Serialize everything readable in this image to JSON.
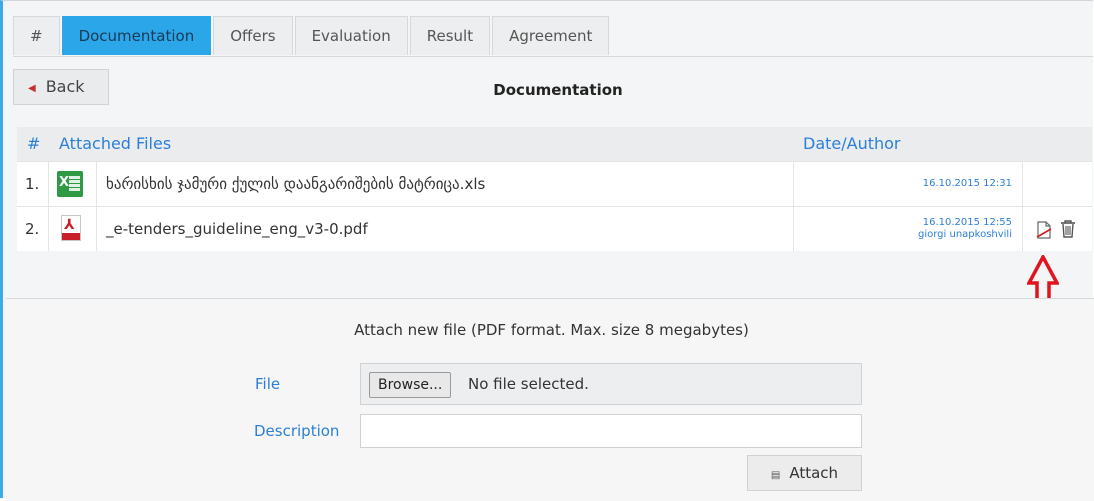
{
  "tabs": [
    {
      "label": "#"
    },
    {
      "label": "Documentation",
      "active": true
    },
    {
      "label": "Offers"
    },
    {
      "label": "Evaluation"
    },
    {
      "label": "Result"
    },
    {
      "label": "Agreement"
    }
  ],
  "toolbar": {
    "back_label": "Back"
  },
  "page": {
    "title": "Documentation"
  },
  "files_table": {
    "headers": {
      "num": "#",
      "files": "Attached Files",
      "date": "Date/Author"
    },
    "rows": [
      {
        "num": "1.",
        "icon": "excel-icon",
        "name": "ხარისხის ჯამური ქულის დაანგარიშების მატრიცა.xls",
        "date": "16.10.2015 12:31",
        "author": ""
      },
      {
        "num": "2.",
        "icon": "pdf-icon",
        "name": "_e-tenders_guideline_eng_v3-0.pdf",
        "date": "16.10.2015 12:55",
        "author": "giorgi unapkoshvili"
      }
    ]
  },
  "attach": {
    "title": "Attach new file (PDF format. Max. size 8 megabytes)",
    "file_label": "File",
    "browse_label": "Browse...",
    "no_file_text": "No file selected.",
    "description_label": "Description",
    "description_value": "",
    "attach_label": "Attach"
  },
  "colors": {
    "accent": "#2aa6e9",
    "link": "#2b7fd6",
    "annotation": "#e0141e",
    "pdf_red": "#c8202a",
    "excel_green": "#2e9a44"
  }
}
